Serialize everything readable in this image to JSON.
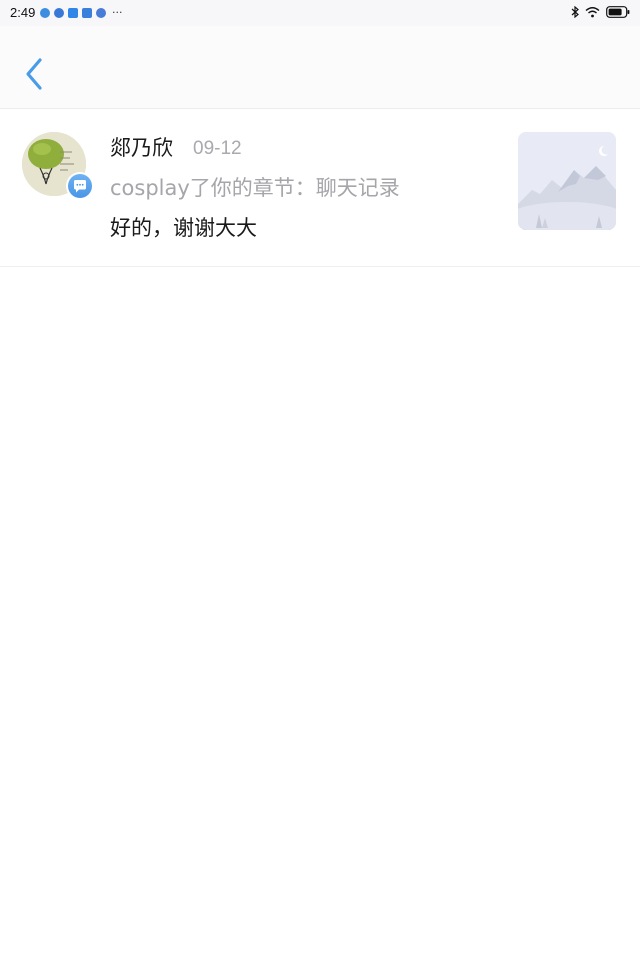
{
  "status_bar": {
    "time": "2:49",
    "more_indicator": "···",
    "battery_icon": "battery-icon",
    "wifi_icon": "wifi-icon",
    "bluetooth_icon": "bluetooth-icon"
  },
  "header": {
    "back_icon": "chevron-left-icon",
    "accent_color": "#4a9be8"
  },
  "messages": [
    {
      "sender": "郯乃欣",
      "date": "09-12",
      "context": "cosplay了你的章节：聊天记录",
      "body": "好的，谢谢大大",
      "badge_icon": "chat-bubble-icon",
      "thumbnail_icon": "mountain-landscape-icon"
    }
  ]
}
